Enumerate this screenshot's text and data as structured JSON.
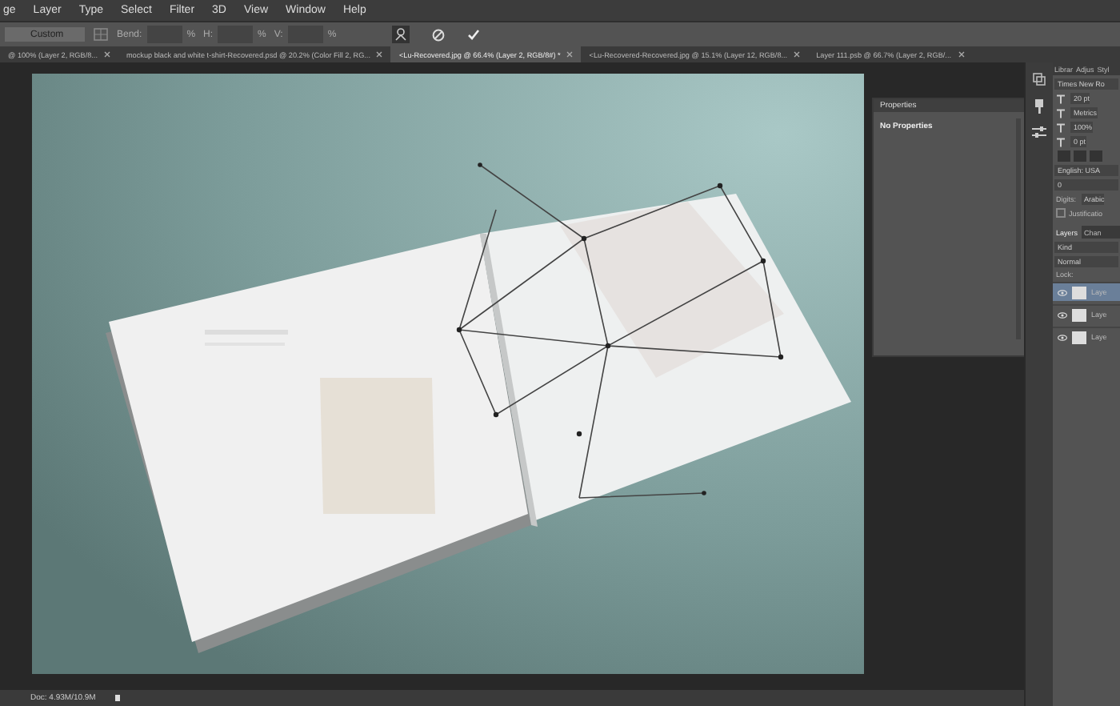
{
  "menu_bar": {
    "items": [
      "ge",
      "Layer",
      "Type",
      "Select",
      "Filter",
      "3D",
      "View",
      "Window",
      "Help"
    ]
  },
  "options_bar": {
    "preset": "Custom",
    "fields": [
      {
        "label": "Bend:",
        "unit": "%"
      },
      {
        "label": "H:",
        "unit": "%"
      },
      {
        "label": "V:",
        "unit": "%"
      }
    ]
  },
  "document_tabs": [
    {
      "label": "@ 100% (Layer 2, RGB/8...",
      "selected": false
    },
    {
      "label": "mockup black and white t-shirt-Recovered.psd @ 20.2% (Color Fill 2, RG...",
      "selected": false
    },
    {
      "label": "<Lu-Recovered.jpg @ 66.4% (Layer 2, RGB/8#) *",
      "selected": true
    },
    {
      "label": "<Lu-Recovered-Recovered.jpg @ 15.1% (Layer 12, RGB/8...",
      "selected": false
    },
    {
      "label": "Layer 111.psb @ 66.7% (Layer 2, RGB/...",
      "selected": false
    }
  ],
  "properties_panel": {
    "title": "Properties",
    "message": "No Properties"
  },
  "character_panel": {
    "tabs": [
      "Librar",
      "Adjus",
      "Styl"
    ],
    "font": "Times New Ro",
    "size": "20 pt",
    "kerning": "Metrics",
    "scale": "100%",
    "baseline": "0 pt",
    "language": "English: USA",
    "shift": "0",
    "digits_label": "Digits:",
    "digits_value": "Arabic",
    "justification": "Justificatio",
    "justification_checked": false
  },
  "layers_panel": {
    "tabs": [
      {
        "label": "Layers",
        "selected": true
      },
      {
        "label": "Chan",
        "selected": false
      }
    ],
    "filter": "Kind",
    "blend_mode": "Normal",
    "lock_label": "Lock:",
    "layers": [
      {
        "name": "Laye",
        "visible": true,
        "selected": true
      },
      {
        "name": "Laye",
        "visible": true,
        "selected": false
      },
      {
        "name": "Laye",
        "visible": true,
        "selected": false
      }
    ]
  },
  "status_bar": {
    "doc_size": "Doc: 4.93M/10.9M"
  }
}
